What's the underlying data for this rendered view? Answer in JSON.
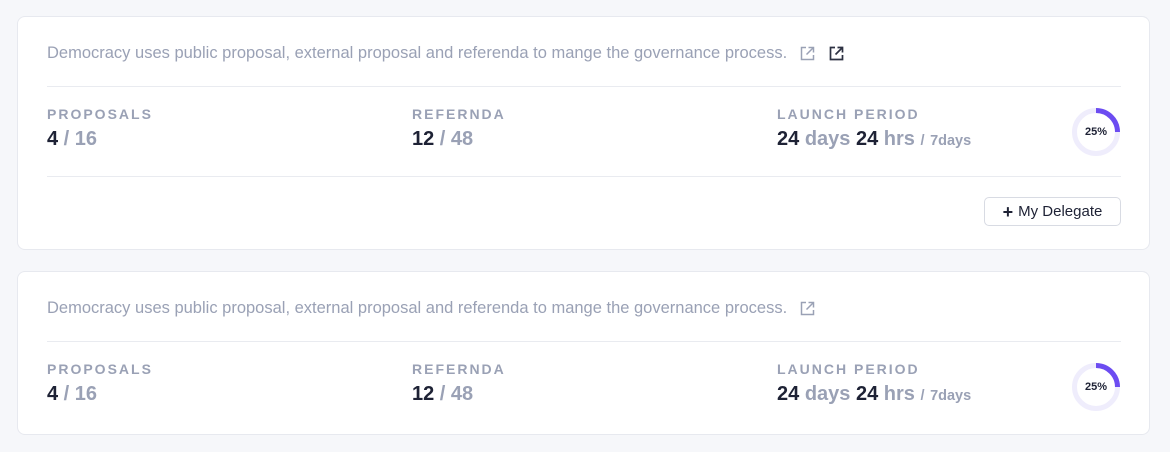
{
  "cards": [
    {
      "description": "Democracy uses public proposal, external proposal and referenda to mange the governance process.",
      "proposals": {
        "label": "PROPOSALS",
        "current": "4",
        "total": "16"
      },
      "referenda": {
        "label": "REFERNDA",
        "current": "12",
        "total": "48"
      },
      "launch_period": {
        "label": "LAUNCH PERIOD",
        "days_value": "24",
        "days_unit": "days",
        "hrs_value": "24",
        "hrs_unit": "hrs",
        "period": "7days"
      },
      "progress": {
        "value": 25,
        "label": "25%"
      },
      "delegate_button": {
        "label": "My Delegate"
      }
    },
    {
      "description": "Democracy uses public proposal, external proposal and referenda to mange the governance process.",
      "proposals": {
        "label": "PROPOSALS",
        "current": "4",
        "total": "16"
      },
      "referenda": {
        "label": "REFERNDA",
        "current": "12",
        "total": "48"
      },
      "launch_period": {
        "label": "LAUNCH PERIOD",
        "days_value": "24",
        "days_unit": "days",
        "hrs_value": "24",
        "hrs_unit": "hrs",
        "period": "7days"
      },
      "progress": {
        "value": 25,
        "label": "25%"
      }
    }
  ],
  "colors": {
    "accent": "#6c4cf1",
    "ring_track": "#efedfc",
    "muted_text": "#9aa1b5",
    "primary_text": "#1e2235"
  },
  "icons": {
    "external_link": "external-link-icon"
  }
}
